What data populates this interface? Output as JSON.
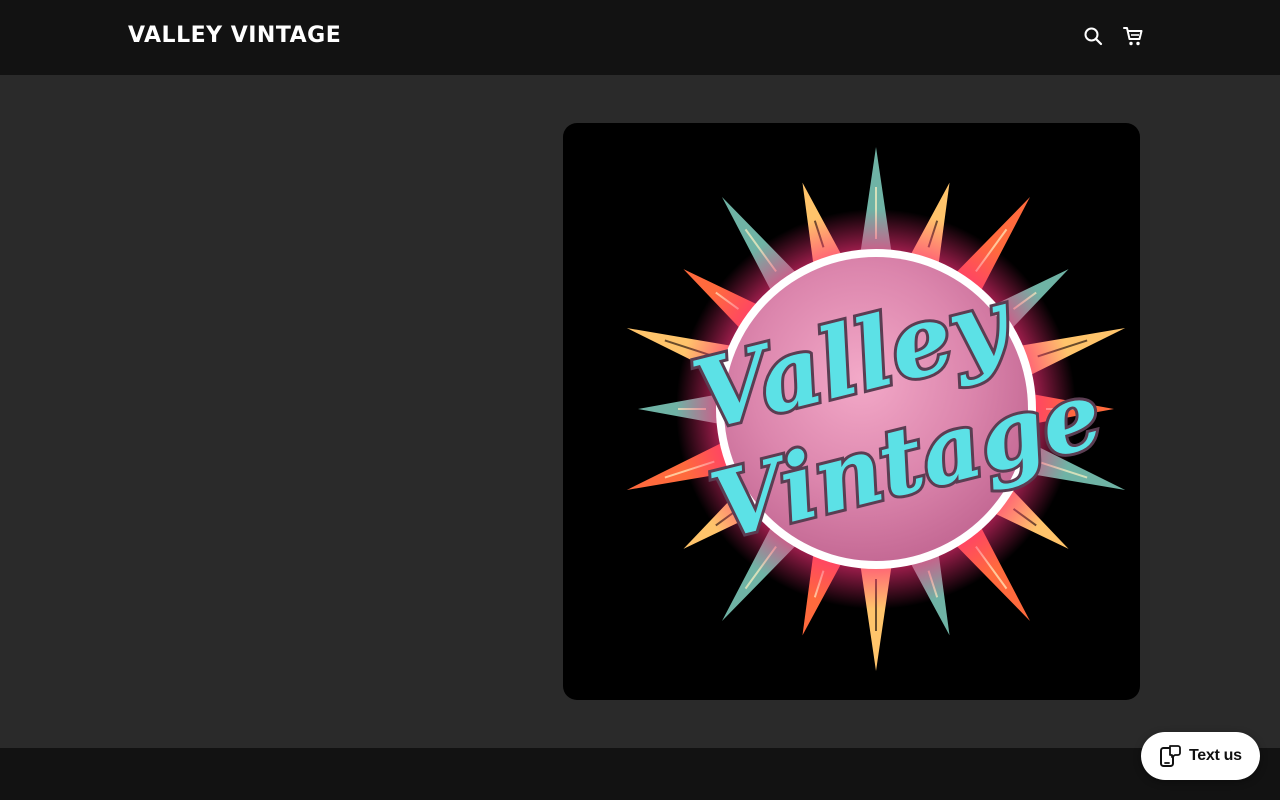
{
  "header": {
    "site_title": "Valley Vintage",
    "search_icon": "search-icon",
    "cart_icon": "cart-icon"
  },
  "hero": {
    "logo_text_line1": "Valley",
    "logo_text_line2": "Vintage"
  },
  "chat_widget": {
    "label": "Text us",
    "icon": "chat-phone-icon"
  },
  "colors": {
    "header_bg": "#121212",
    "page_bg": "#2a2a2a",
    "logo_teal": "#5ce1e6",
    "logo_pink": "#e48ab0",
    "ray_orange": "#ff6a3d",
    "ray_yellow": "#ffc46b",
    "ray_teal": "#6fb3a5"
  }
}
